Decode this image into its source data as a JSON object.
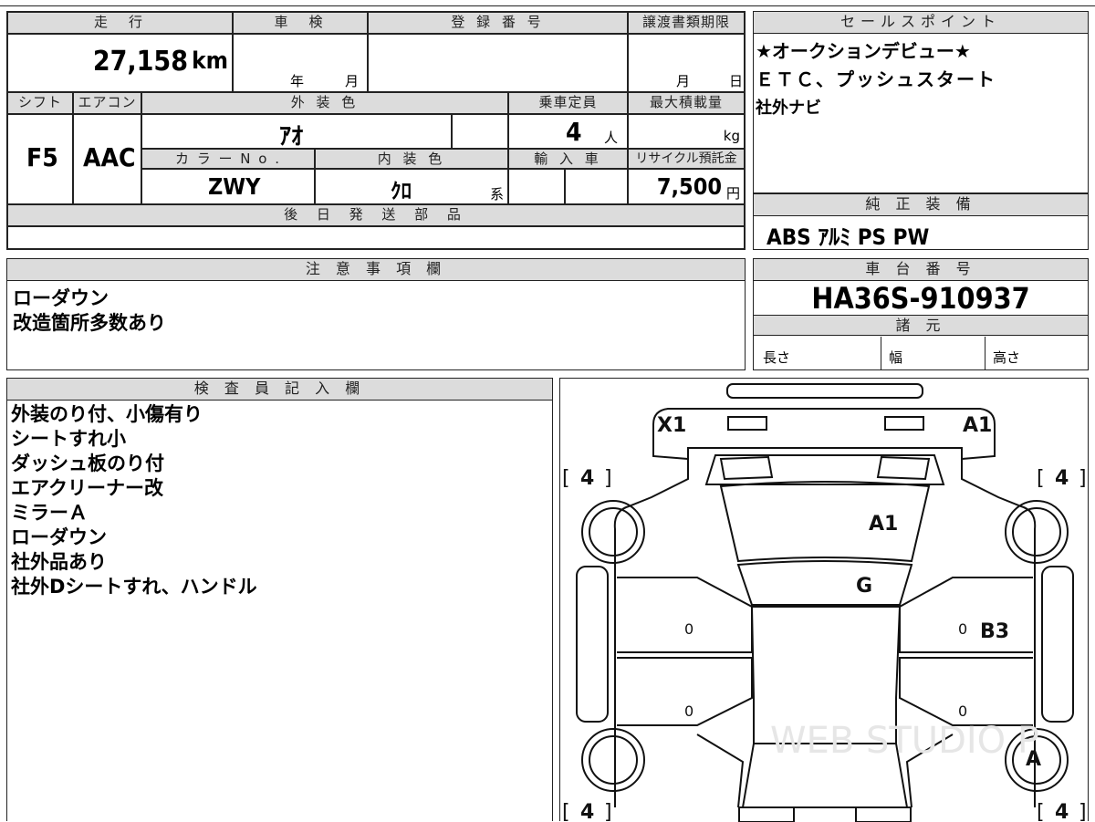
{
  "vehicle": {
    "mileage_label": "走　行",
    "mileage": "27,158",
    "mileage_unit": "km",
    "inspection_label": "車　検",
    "year_label": "年",
    "month_label": "月",
    "registration_label": "登 録 番 号",
    "transfer_label": "譲渡書類期限",
    "transfer_month": "月",
    "transfer_day": "日",
    "shift_label": "シフト",
    "shift": "F5",
    "aircon_label": "エアコン",
    "aircon": "AAC",
    "exterior_label": "外 装 色",
    "exterior": "ｱｵ",
    "capacity_label": "乗車定員",
    "capacity": "4",
    "capacity_unit": "人",
    "maxload_label": "最大積載量",
    "maxload_unit": "kg",
    "colorno_label": "カ ラ ー N o .",
    "colorno": "ZWY",
    "interior_label": "内 装 色",
    "interior": "ｸﾛ",
    "interior_suffix": "系",
    "import_label": "輸 入 車",
    "recycle_label": "リサイクル預託金",
    "recycle": "7,500",
    "recycle_unit": "円",
    "later_parts_label": "後 日 発 送 部 品"
  },
  "sales_points": {
    "label": "セールスポイント",
    "lines": [
      "★オークションデビュー★",
      "ＥＴＣ、プッシュスタート",
      "社外ナビ"
    ]
  },
  "equipment": {
    "label": "純 正 装 備",
    "value": "ABS ｱﾙﾐ PS PW"
  },
  "notes": {
    "label": "注 意 事 項 欄",
    "lines": [
      "ローダウン",
      "改造箇所多数あり"
    ]
  },
  "chassis": {
    "label": "車 台 番 号",
    "value": "HA36S-910937",
    "specs_label": "諸 元",
    "length_label": "長さ",
    "width_label": "幅",
    "height_label": "高さ"
  },
  "inspector": {
    "label": "検 査 員 記 入 欄",
    "lines": [
      "外装のり付、小傷有り",
      "シートすれ小",
      "ダッシュ板のり付",
      "エアクリーナー改",
      "ミラーＡ",
      "ローダウン",
      "社外品あり",
      "社外Dシートすれ、ハンドル"
    ]
  },
  "diagram": {
    "marks": {
      "front_left": "X1",
      "front_right": "A1",
      "windshield": "A1",
      "hood_glass": "G",
      "right_front_door": "B3",
      "right_rear_wheel": "A"
    },
    "tires": {
      "front_left": "4",
      "front_right": "4",
      "rear_left": "4",
      "rear_right": "4"
    },
    "door_zeros": [
      "0",
      "0",
      "0",
      "0"
    ],
    "watermark": "WEB STUDIO P"
  }
}
